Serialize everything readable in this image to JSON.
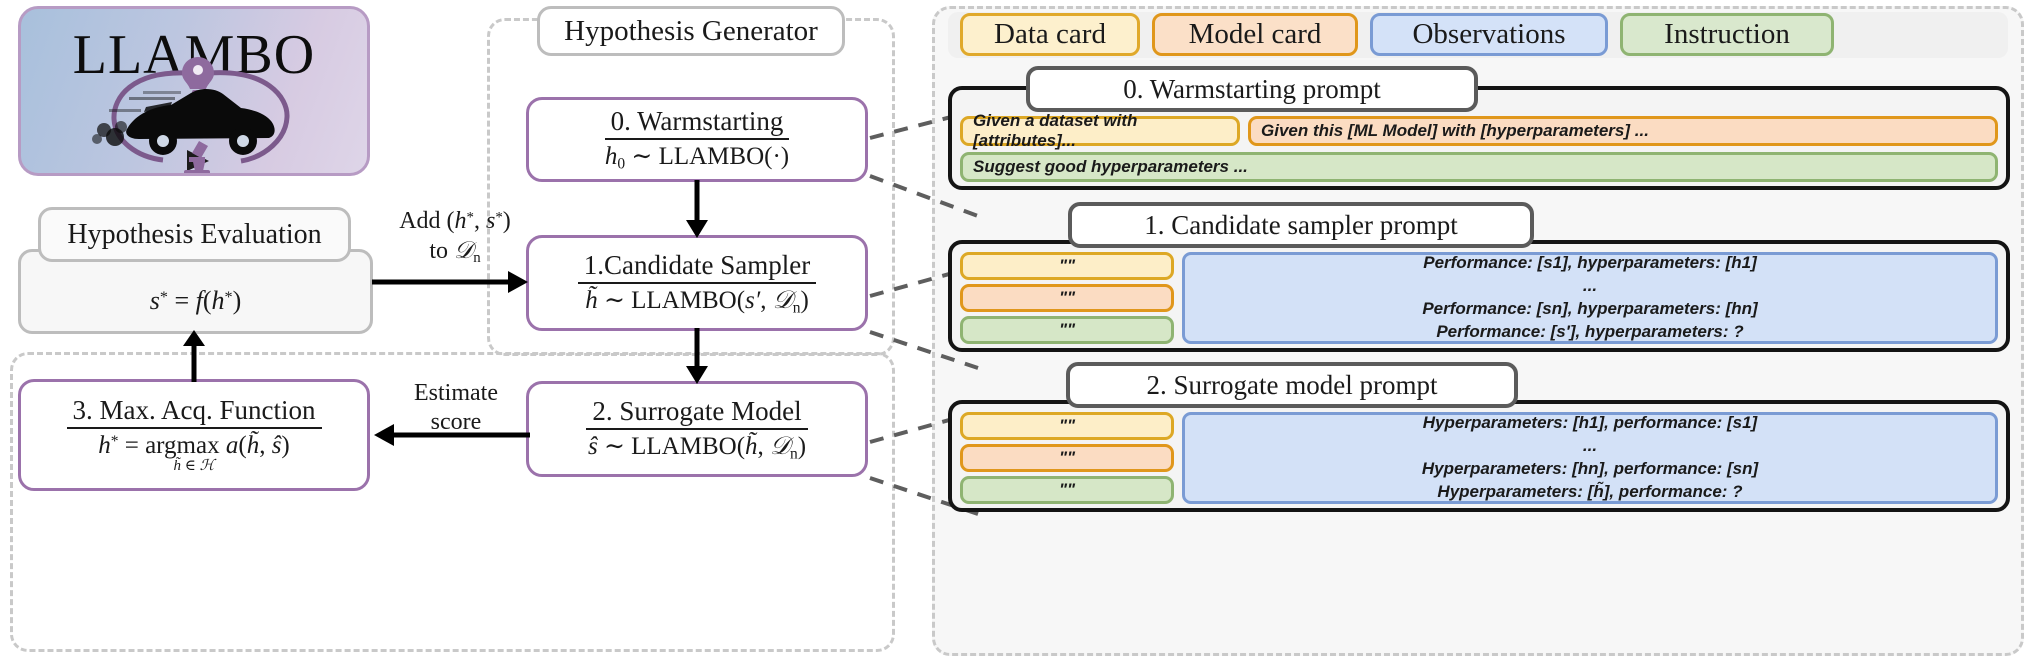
{
  "logo": {
    "title": "LLAMBO",
    "icons": [
      "lightbulb-icon",
      "car-icon",
      "microscope-icon",
      "cycle-arrows-icon"
    ]
  },
  "left_column": {
    "hypothesis_evaluation": {
      "title": "Hypothesis Evaluation",
      "formula_html": "s* = f(h*)"
    },
    "max_acq": {
      "title": "3. Max. Acq. Function",
      "formula_top": "3. Max. Acq. Function",
      "formula_bottom": "h* = argmax a(h̃, ŝ)",
      "formula_constraint": "h̃ ∈ H"
    }
  },
  "center_column": {
    "generator_title": "Hypothesis Generator",
    "steps": [
      {
        "id": "warmstarting",
        "title": "0. Warmstarting",
        "formula": "h0 ~ LLAMBO(·)"
      },
      {
        "id": "candidate-sampler",
        "title": "1.Candidate Sampler",
        "formula": "h̃ ~ LLAMBO(s′, Dn)"
      },
      {
        "id": "surrogate-model",
        "title": "2. Surrogate Model",
        "formula": "ŝ ~ LLAMBO(h̃, Dn)"
      }
    ]
  },
  "edge_labels": {
    "add_to_dataset_line1": "Add (h*, s*)",
    "add_to_dataset_line2": "to Dn",
    "estimate_line1": "Estimate",
    "estimate_line2": "score"
  },
  "legend": [
    {
      "label": "Data card",
      "key": "data-card",
      "color": "#fdf0cd",
      "border": "#e0a92b"
    },
    {
      "label": "Model card",
      "key": "model-card",
      "color": "#fbe0c8",
      "border": "#e0971b"
    },
    {
      "label": "Observations",
      "key": "observations",
      "color": "#d4e2f8",
      "border": "#7a9bd4"
    },
    {
      "label": "Instruction",
      "key": "instruction",
      "color": "#d9e8cd",
      "border": "#8fb472"
    }
  ],
  "prompts": [
    {
      "id": "warmstarting-prompt",
      "title": "0. Warmstarting prompt",
      "row1": [
        {
          "kind": "data-card",
          "text": "Given a dataset with [attributes]..."
        },
        {
          "kind": "model-card",
          "text": "Given this [ML Model] with [hyperparameters] ..."
        }
      ],
      "row2": [
        {
          "kind": "instruction",
          "text": "Suggest good hyperparameters ..."
        }
      ]
    },
    {
      "id": "candidate-sampler-prompt",
      "title": "1. Candidate sampler prompt",
      "cards": [
        {
          "kind": "data-card",
          "text": "\"\""
        },
        {
          "kind": "model-card",
          "text": "\"\""
        },
        {
          "kind": "instruction",
          "text": "\"\""
        }
      ],
      "observations_lines": [
        "Performance: [s1], hyperparameters: [h1]",
        "...",
        "Performance: [sn], hyperparameters: [hn]",
        "Performance: [s′], hyperparameters: ?"
      ]
    },
    {
      "id": "surrogate-model-prompt",
      "title": "2. Surrogate model prompt",
      "cards": [
        {
          "kind": "data-card",
          "text": "\"\""
        },
        {
          "kind": "model-card",
          "text": "\"\""
        },
        {
          "kind": "instruction",
          "text": "\"\""
        }
      ],
      "observations_lines": [
        "Hyperparameters: [h1], performance: [s1]",
        "...",
        "Hyperparameters: [hn], performance: [sn]",
        "Hyperparameters: [h̃], performance: ?"
      ]
    }
  ],
  "colors": {
    "purple_border": "#9b72ab",
    "gray_border": "#bdbdbd",
    "dark_border": "#141414",
    "dashed": "#c9c9c9"
  }
}
